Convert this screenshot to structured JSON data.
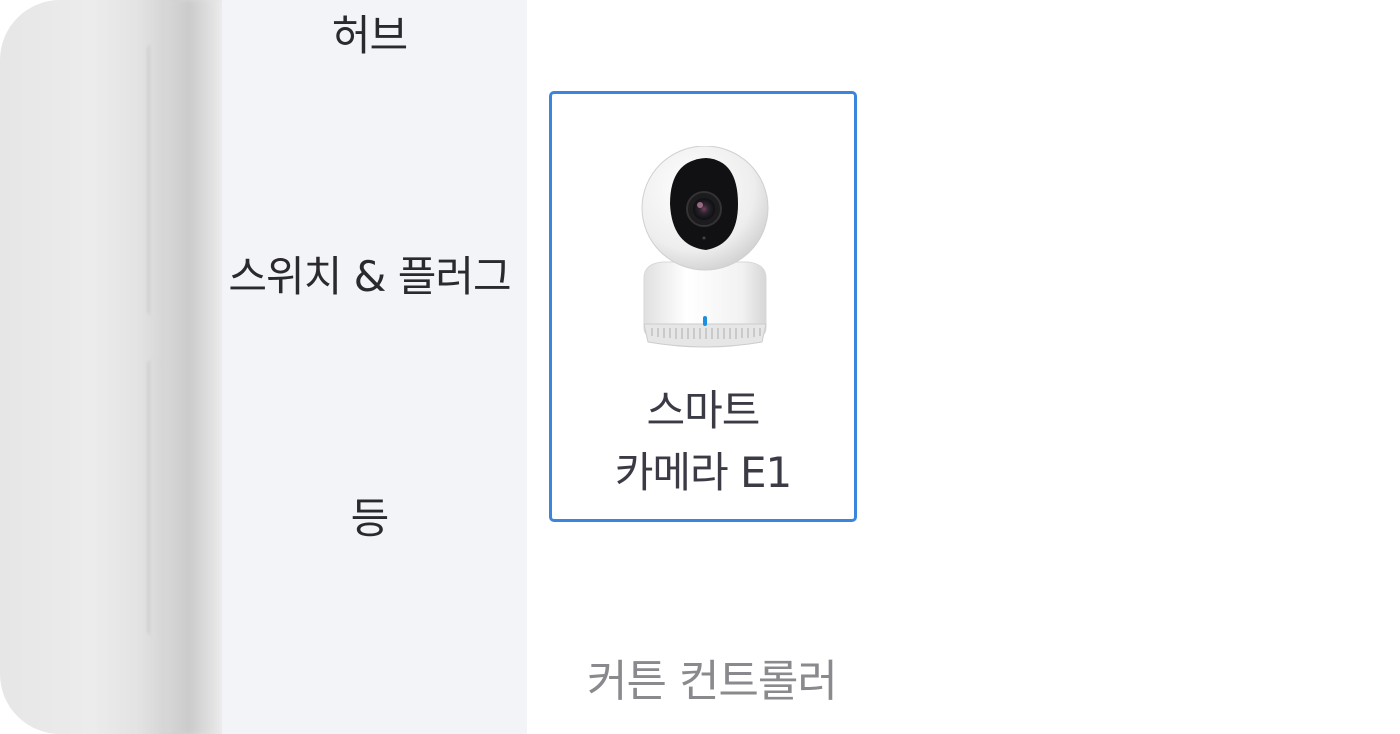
{
  "sidebar": {
    "items": [
      {
        "label": "허브"
      },
      {
        "label": "스위치 & 플러그"
      },
      {
        "label": "등"
      },
      {
        "label": ""
      }
    ]
  },
  "main": {
    "device_card": {
      "name_line1": "스마트",
      "name_line2": "카메라 E1",
      "image": "smart-camera-e1-image",
      "selected": true
    },
    "next_category": "커튼 컨트롤러"
  },
  "colors": {
    "accent": "#3a86dd",
    "sidebar_bg": "#f3f4f8",
    "text_primary": "#2a2a2e",
    "text_muted": "#8a8a8e"
  }
}
